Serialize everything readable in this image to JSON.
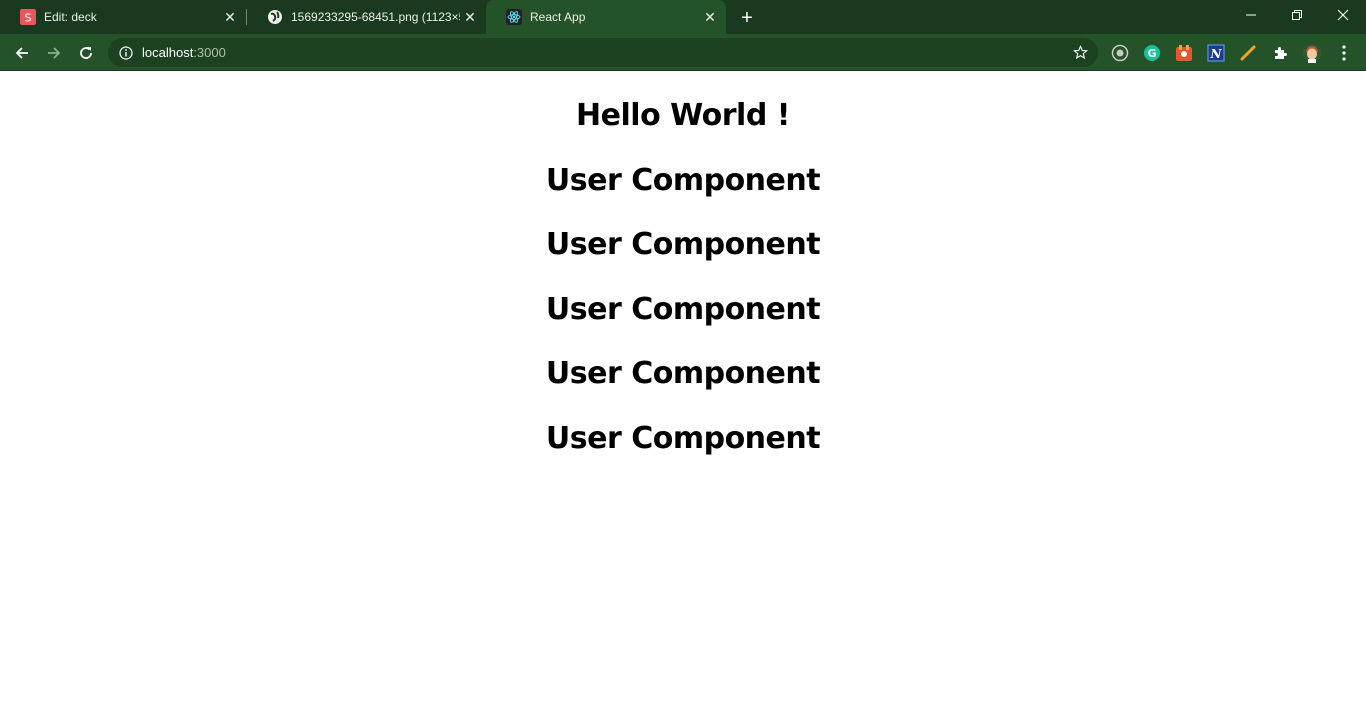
{
  "tabs": [
    {
      "title": "Edit: deck",
      "favicon": "slides-icon"
    },
    {
      "title": "1569233295-68451.png (1123×5",
      "favicon": "globe-icon"
    },
    {
      "title": "React App",
      "favicon": "react-icon",
      "active": true
    }
  ],
  "toolbar": {
    "url_host": "localhost",
    "url_port": ":3000"
  },
  "page": {
    "heading": "Hello World !",
    "components": [
      "User Component",
      "User Component",
      "User Component",
      "User Component",
      "User Component"
    ]
  },
  "colors": {
    "tabstrip": "#1a3a1f",
    "toolbar": "#245229",
    "omnibox": "#1c4221",
    "page_background": "#ffffff"
  }
}
